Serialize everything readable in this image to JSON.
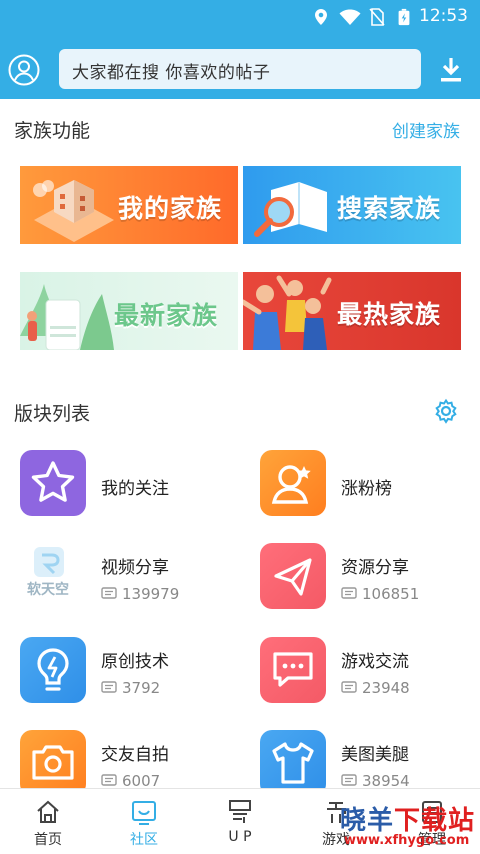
{
  "status_bar": {
    "time": "12:53"
  },
  "search": {
    "placeholder": "大家都在搜  你喜欢的帖子"
  },
  "family": {
    "title": "家族功能",
    "create_link": "创建家族",
    "banners": [
      {
        "label": "我的家族"
      },
      {
        "label": "搜索家族"
      },
      {
        "label": "最新家族"
      },
      {
        "label": "最热家族"
      }
    ]
  },
  "boards": {
    "title": "版块列表",
    "items": [
      {
        "name": "我的关注",
        "count": ""
      },
      {
        "name": "涨粉榜",
        "count": ""
      },
      {
        "name": "视频分享",
        "count": "139979"
      },
      {
        "name": "资源分享",
        "count": "106851"
      },
      {
        "name": "原创技术",
        "count": "3792"
      },
      {
        "name": "游戏交流",
        "count": "23948"
      },
      {
        "name": "交友自拍",
        "count": "6007"
      },
      {
        "name": "美图美腿",
        "count": "38954"
      }
    ],
    "video_logo_text": "软天空"
  },
  "tabbar": {
    "tabs": [
      {
        "label": "首页"
      },
      {
        "label": "社区"
      },
      {
        "label": "U P"
      },
      {
        "label": "游戏"
      },
      {
        "label": "管理"
      }
    ]
  },
  "watermark": {
    "line1_a": "晓羊",
    "line1_b": "下载站",
    "line2": "www.xfhygo.com"
  },
  "colors": {
    "accent": "#34AEE5",
    "header_bg": "#34AEE5",
    "active_tab": "#34AEE5"
  },
  "icons": {
    "status": [
      "location-icon",
      "wifi-icon",
      "no-sim-icon",
      "battery-charging-icon"
    ],
    "header": [
      "user-avatar-icon",
      "download-icon"
    ],
    "boards": [
      "star-icon",
      "fans-rank-icon",
      "video-logo",
      "paper-plane-icon",
      "lightbulb-icon",
      "chat-icon",
      "camera-icon",
      "tshirt-icon"
    ],
    "tabs": [
      "home-icon",
      "community-icon",
      "up-icon",
      "game-icon",
      "manage-icon"
    ]
  }
}
